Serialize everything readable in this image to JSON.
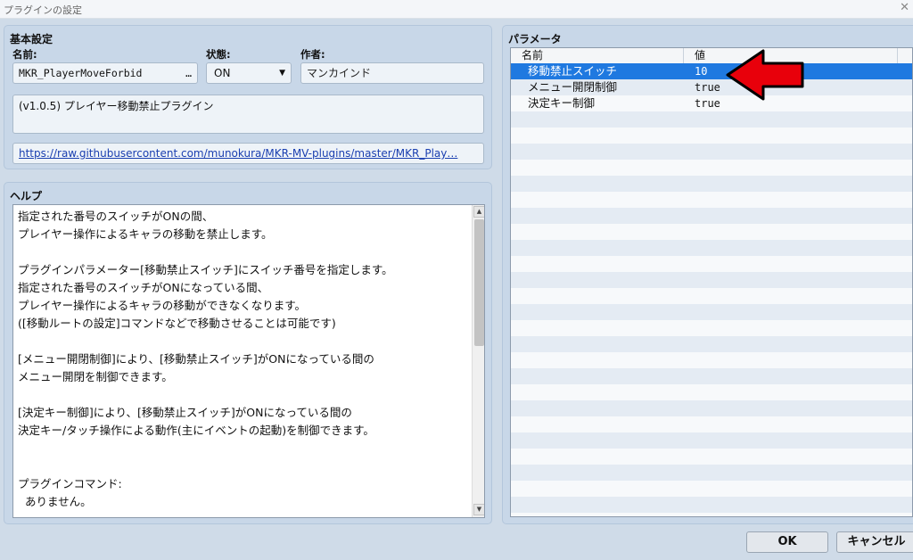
{
  "window": {
    "title": "プラグインの設定",
    "close_glyph": "✕"
  },
  "basic": {
    "title": "基本設定",
    "name_label": "名前:",
    "name_value": "MKR_PlayerMoveForbid",
    "name_button": "…",
    "state_label": "状態:",
    "state_value": "ON",
    "state_arrow": "▼",
    "author_label": "作者:",
    "author_value": "マンカインド",
    "description": "(v1.0.5) プレイヤー移動禁止プラグイン",
    "url": "https://raw.githubusercontent.com/munokura/MKR-MV-plugins/master/MKR_Play…"
  },
  "help": {
    "title": "ヘルプ",
    "text": "指定された番号のスイッチがONの間、\nプレイヤー操作によるキャラの移動を禁止します。\n\nプラグインパラメーター[移動禁止スイッチ]にスイッチ番号を指定します。\n指定された番号のスイッチがONになっている間、\nプレイヤー操作によるキャラの移動ができなくなります。\n([移動ルートの設定]コマンドなどで移動させることは可能です)\n\n[メニュー開閉制御]により、[移動禁止スイッチ]がONになっている間の\nメニュー開閉を制御できます。\n\n[決定キー制御]により、[移動禁止スイッチ]がONになっている間の\n決定キー/タッチ操作による動作(主にイベントの起動)を制御できます。\n\n\nプラグインコマンド:\n  ありません。",
    "scroll_up": "▲",
    "scroll_down": "▼"
  },
  "params": {
    "title": "パラメータ",
    "col_name": "名前",
    "col_value": "値",
    "rows": [
      {
        "name": "移動禁止スイッチ",
        "value": "10",
        "selected": true
      },
      {
        "name": "メニュー開閉制御",
        "value": "true",
        "selected": false
      },
      {
        "name": "決定キー制御",
        "value": "true",
        "selected": false
      }
    ]
  },
  "annotation": {
    "arrow_color": "#e8000b",
    "arrow_target": "移動禁止スイッチ"
  },
  "footer": {
    "ok": "OK",
    "cancel": "キャンセル"
  },
  "colors": {
    "selection": "#1f79e0",
    "panel": "#c8d7e8",
    "background": "#cfdbe8"
  }
}
